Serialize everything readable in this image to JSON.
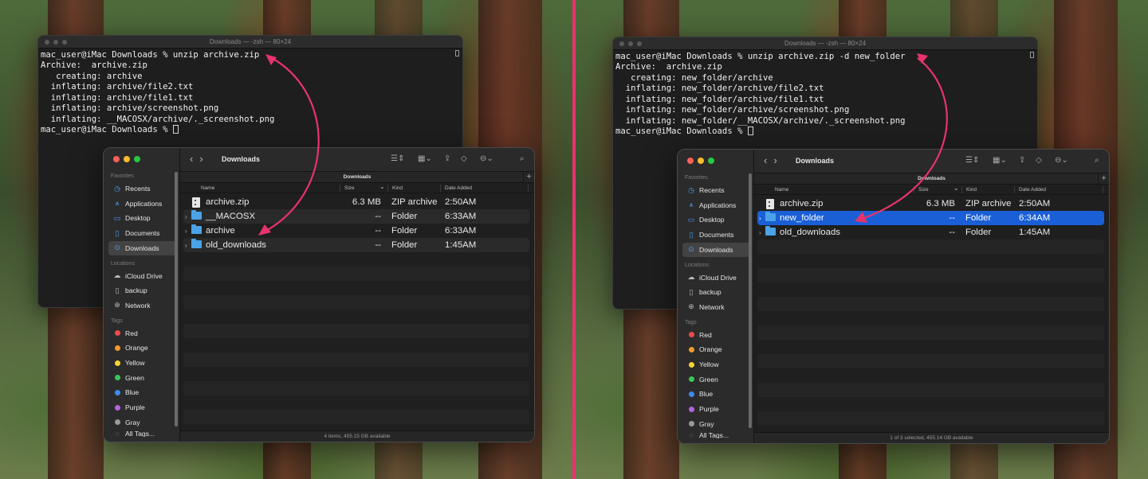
{
  "left": {
    "terminal": {
      "title": "Downloads — -zsh — 80×24",
      "lines": [
        "mac_user@iMac Downloads % unzip archive.zip",
        "Archive:  archive.zip",
        "   creating: archive",
        "  inflating: archive/file2.txt",
        "  inflating: archive/file1.txt",
        "  inflating: archive/screenshot.png",
        "  inflating: __MACOSX/archive/._screenshot.png"
      ],
      "prompt": "mac_user@iMac Downloads % "
    },
    "finder": {
      "title": "Downloads",
      "path_title": "Downloads",
      "status": "4 items, 455.15 GB available",
      "rows": [
        {
          "name": "archive.zip",
          "size": "6.3 MB",
          "kind": "ZIP archive",
          "date": "2:50AM",
          "type": "file"
        },
        {
          "name": "__MACOSX",
          "size": "--",
          "kind": "Folder",
          "date": "6:33AM",
          "type": "folder"
        },
        {
          "name": "archive",
          "size": "--",
          "kind": "Folder",
          "date": "6:33AM",
          "type": "folder"
        },
        {
          "name": "old_downloads",
          "size": "--",
          "kind": "Folder",
          "date": "1:45AM",
          "type": "folder"
        }
      ]
    }
  },
  "right": {
    "terminal": {
      "title": "Downloads — -zsh — 80×24",
      "lines": [
        "mac_user@iMac Downloads % unzip archive.zip -d new_folder",
        "Archive:  archive.zip",
        "   creating: new_folder/archive",
        "  inflating: new_folder/archive/file2.txt",
        "  inflating: new_folder/archive/file1.txt",
        "  inflating: new_folder/archive/screenshot.png",
        "  inflating: new_folder/__MACOSX/archive/._screenshot.png"
      ],
      "prompt": "mac_user@iMac Downloads % "
    },
    "finder": {
      "title": "Downloads",
      "path_title": "Downloads",
      "status": "1 of 3 selected, 455.14 GB available",
      "rows": [
        {
          "name": "archive.zip",
          "size": "6.3 MB",
          "kind": "ZIP archive",
          "date": "2:50AM",
          "type": "file"
        },
        {
          "name": "new_folder",
          "size": "--",
          "kind": "Folder",
          "date": "6:34AM",
          "type": "folder",
          "selected": true
        },
        {
          "name": "old_downloads",
          "size": "--",
          "kind": "Folder",
          "date": "1:45AM",
          "type": "folder"
        }
      ]
    }
  },
  "columns": {
    "name": "Name",
    "size": "Size",
    "kind": "Kind",
    "date": "Date Added"
  },
  "sidebar": {
    "favorites_label": "Favorites",
    "favorites": [
      {
        "label": "Recents",
        "icon": "clock-icon"
      },
      {
        "label": "Applications",
        "icon": "applications-icon"
      },
      {
        "label": "Desktop",
        "icon": "desktop-icon"
      },
      {
        "label": "Documents",
        "icon": "document-icon"
      },
      {
        "label": "Downloads",
        "icon": "download-icon",
        "selected": true
      }
    ],
    "locations_label": "Locations",
    "locations": [
      {
        "label": "iCloud Drive",
        "icon": "cloud-icon"
      },
      {
        "label": "backup",
        "icon": "drive-icon"
      },
      {
        "label": "Network",
        "icon": "globe-icon"
      }
    ],
    "tags_label": "Tags",
    "tags": [
      {
        "label": "Red",
        "color": "#ee4b4b"
      },
      {
        "label": "Orange",
        "color": "#f39a2c"
      },
      {
        "label": "Yellow",
        "color": "#f5d430"
      },
      {
        "label": "Green",
        "color": "#3cc65a"
      },
      {
        "label": "Blue",
        "color": "#3a8cf0"
      },
      {
        "label": "Purple",
        "color": "#b264e0"
      },
      {
        "label": "Gray",
        "color": "#9a9a9a"
      }
    ],
    "all_tags": "All Tags..."
  },
  "colors": {
    "accent": "#e8336d",
    "selection": "#1a5fd6",
    "folder": "#4aa3e8"
  }
}
